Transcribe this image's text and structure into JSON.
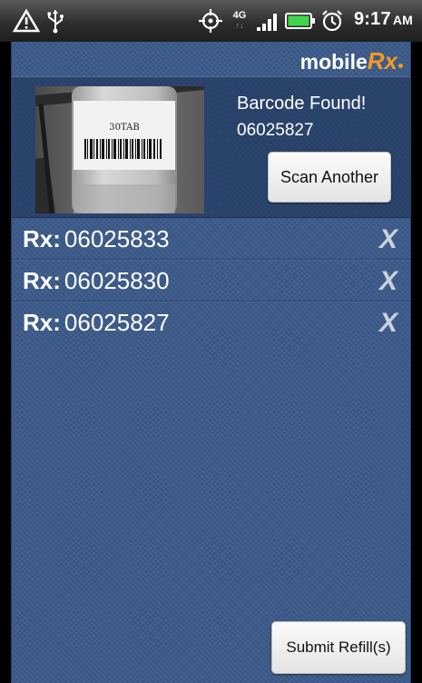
{
  "status_bar": {
    "icons": [
      "warning-icon",
      "usb-icon",
      "gps-icon",
      "network-4g-icon",
      "signal-icon",
      "battery-icon",
      "alarm-icon"
    ],
    "network_label": "4G",
    "time": "9:17",
    "ampm": "AM"
  },
  "header": {
    "logo_text": "mobile",
    "logo_accent": "Rx",
    "accent_color": "#f39a1f"
  },
  "scan": {
    "image_label": "30TAB",
    "title": "Barcode Found!",
    "code": "06025827",
    "scan_button": "Scan Another"
  },
  "rx_list": {
    "prefix": "Rx:",
    "items": [
      {
        "number": "06025833"
      },
      {
        "number": "06025830"
      },
      {
        "number": "06025827"
      }
    ],
    "delete_glyph": "X"
  },
  "footer": {
    "submit_button": "Submit Refill(s)"
  }
}
